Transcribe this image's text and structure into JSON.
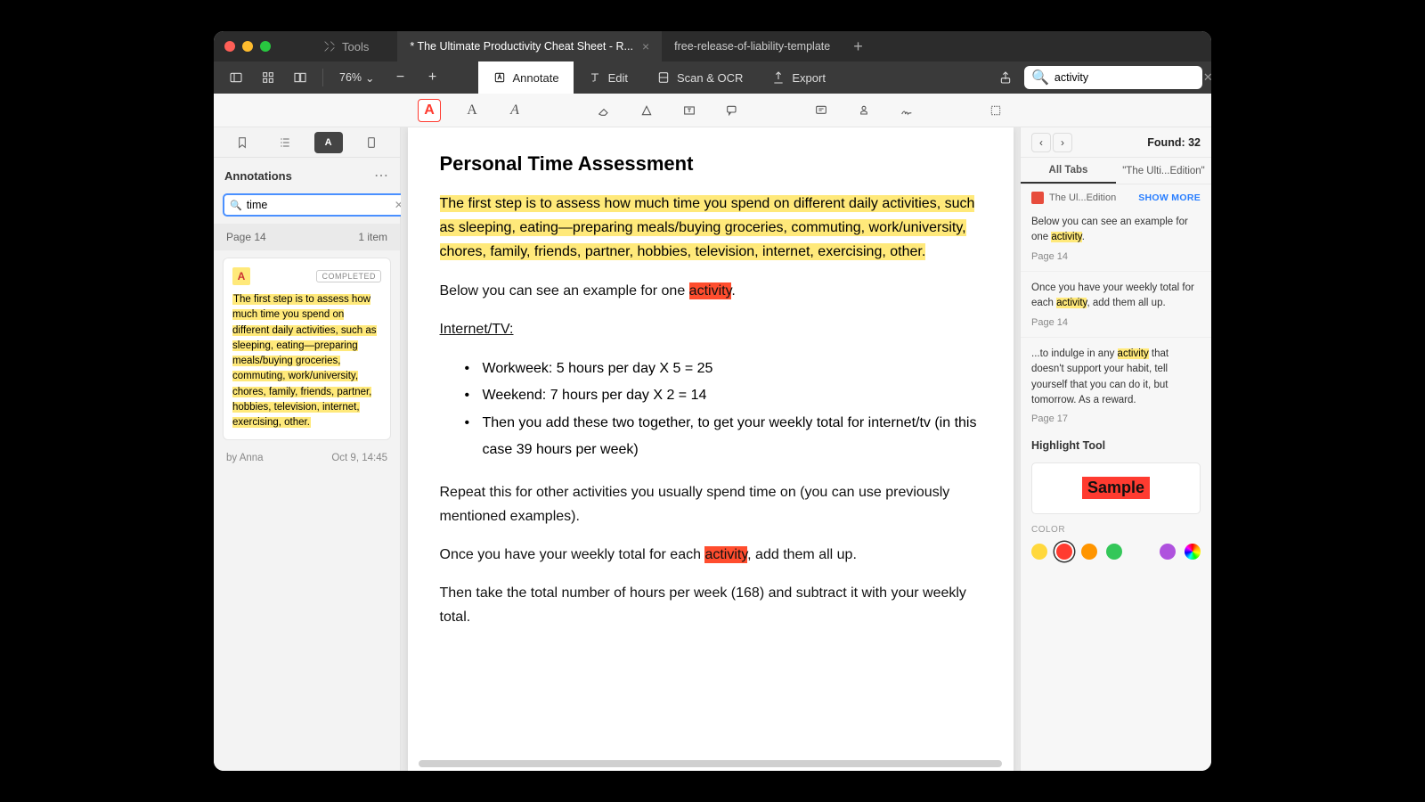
{
  "titlebar": {
    "tools_label": "Tools",
    "tabs": [
      {
        "label": "* The Ultimate Productivity Cheat Sheet - R...",
        "active": true
      },
      {
        "label": "free-release-of-liability-template",
        "active": false
      }
    ]
  },
  "toolbar": {
    "zoom": "76%",
    "modes": {
      "annotate": "Annotate",
      "edit": "Edit",
      "scan": "Scan & OCR",
      "export": "Export"
    },
    "search_value": "activity"
  },
  "left": {
    "title": "Annotations",
    "search_value": "time",
    "page_label": "Page 14",
    "item_count": "1 item",
    "badge_letter": "A",
    "status": "COMPLETED",
    "excerpt_pre": "The first step is to assess how much ",
    "excerpt_hl": "time",
    "excerpt_post": " you spend on different daily activities, such as sleeping, eating—preparing meals/buying groceries, commuting, work/university, chores, family, friends, partner, hobbies, television, internet, exercising, other.",
    "author": "by Anna",
    "date": "Oct 9, 14:45"
  },
  "doc": {
    "heading": "Personal Time Assessment",
    "p1": "The first step is to assess how much time you spend on different daily activities, such as sleeping, eating—preparing meals/buying groceries, commuting, work/university, chores, family, friends, partner, hobbies, television, internet, exercising, other.",
    "p2a": "Below you can see an example for one ",
    "p2hl": "activity",
    "p2b": ".",
    "sub": "Internet/TV:",
    "li1": "Workweek: 5 hours per day X 5 = 25",
    "li2": "Weekend: 7 hours per day X 2 = 14",
    "li3": "Then you add these two together, to get your weekly total for internet/tv (in this case 39 hours per week)",
    "p3": "Repeat this for other activities you usually spend time on (you can use previously mentioned examples).",
    "p4a": "Once you have your weekly total for each ",
    "p4hl": "activity",
    "p4b": ", add them all up.",
    "p5": "Then take the total number of hours per week (168) and subtract it with your weekly total."
  },
  "right": {
    "found": "Found: 32",
    "tab_all": "All Tabs",
    "tab_this": "\"The Ulti...Edition\"",
    "src": "The Ul...Edition",
    "more": "SHOW MORE",
    "r1a": "Below you can see an example for one ",
    "r1hl": "activity",
    "r1b": ".",
    "r1pg": "Page 14",
    "r2a": "Once you have your weekly total for each ",
    "r2hl": "activity",
    "r2b": ", add them all up.",
    "r2pg": "Page 14",
    "r3a": "...to indulge in any ",
    "r3hl": "activity",
    "r3b": " that doesn't support your habit, tell yourself that you can do it, but tomorrow. As a reward.",
    "r3pg": "Page 17",
    "hl_title": "Highlight Tool",
    "sample": "Sample",
    "color_lbl": "COLOR",
    "colors": [
      "#ffd83d",
      "#ff3b30",
      "#ff9500",
      "#34c759",
      "#af52de"
    ]
  }
}
